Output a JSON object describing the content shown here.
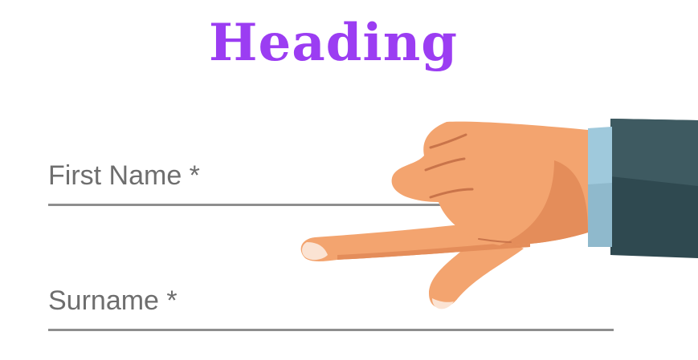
{
  "form": {
    "heading": "Heading",
    "first_name": {
      "label": "First Name *",
      "value": ""
    },
    "surname": {
      "label": "Surname *",
      "value": ""
    }
  },
  "illustration": {
    "icon": "pointing-hand-icon"
  },
  "colors": {
    "heading": "#9b3df2",
    "label": "#6e6e6e",
    "underline": "#8e8e8e",
    "skin": "#f3a46f",
    "skin_shadow": "#e48d5a",
    "cuff": "#9fc9dc",
    "sleeve": "#2f4950"
  }
}
